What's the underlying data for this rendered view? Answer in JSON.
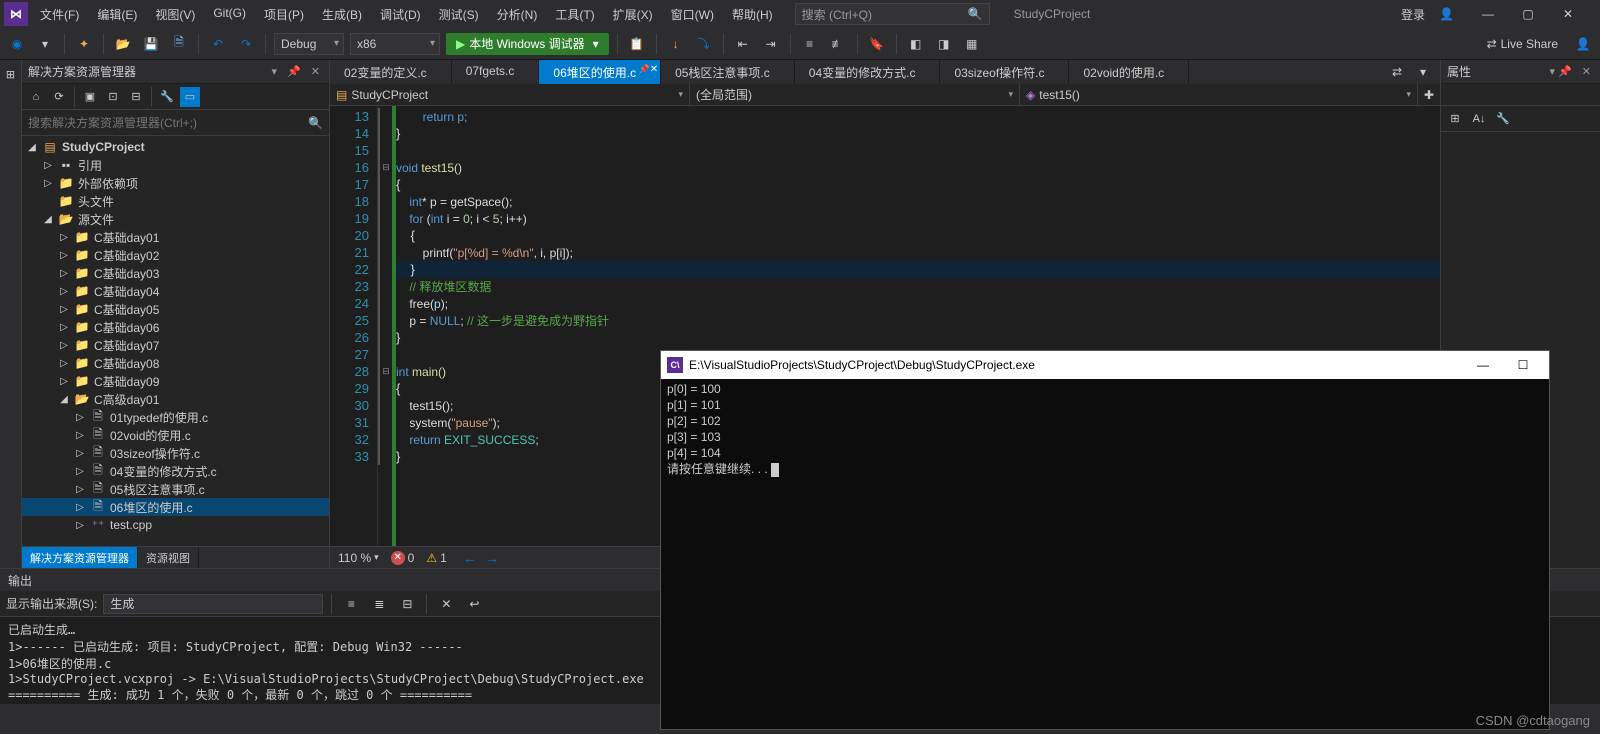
{
  "menu": {
    "file": "文件(F)",
    "edit": "编辑(E)",
    "view": "视图(V)",
    "git": "Git(G)",
    "project": "项目(P)",
    "build": "生成(B)",
    "debug": "调试(D)",
    "test": "测试(S)",
    "analyze": "分析(N)",
    "tools": "工具(T)",
    "extensions": "扩展(X)",
    "window": "窗口(W)",
    "help": "帮助(H)"
  },
  "searchPlaceholder": "搜索 (Ctrl+Q)",
  "appTitle": "StudyCProject",
  "login": "登录",
  "toolbar": {
    "config": "Debug",
    "platform": "x86",
    "start": "本地 Windows 调试器",
    "liveShare": "Live Share"
  },
  "solExp": {
    "title": "解决方案资源管理器",
    "searchPlaceholder": "搜索解决方案资源管理器(Ctrl+;)",
    "tabs": {
      "sol": "解决方案资源管理器",
      "res": "资源视图"
    }
  },
  "tree": {
    "project": "StudyCProject",
    "refs": "引用",
    "extdep": "外部依赖项",
    "headers": "头文件",
    "sources": "源文件",
    "folders": [
      "C基础day01",
      "C基础day02",
      "C基础day03",
      "C基础day04",
      "C基础day05",
      "C基础day06",
      "C基础day07",
      "C基础day08",
      "C基础day09",
      "C高级day01"
    ],
    "files": [
      "01typedef的使用.c",
      "02void的使用.c",
      "03sizeof操作符.c",
      "04变量的修改方式.c",
      "05栈区注意事项.c",
      "06堆区的使用.c",
      "test.cpp"
    ]
  },
  "fileTabs": [
    {
      "name": "02变量的定义.c"
    },
    {
      "name": "07fgets.c"
    },
    {
      "name": "06堆区的使用.c",
      "active": true
    },
    {
      "name": "05栈区注意事项.c"
    },
    {
      "name": "04变量的修改方式.c"
    },
    {
      "name": "03sizeof操作符.c"
    },
    {
      "name": "02void的使用.c"
    }
  ],
  "breadcrumb": {
    "proj": "StudyCProject",
    "scope": "(全局范围)",
    "func": "test15()"
  },
  "code": {
    "lines": [
      13,
      14,
      15,
      16,
      17,
      18,
      19,
      20,
      21,
      22,
      23,
      24,
      25,
      26,
      27,
      28,
      29,
      30,
      31,
      32,
      33
    ],
    "l13": "        return p;",
    "l16": {
      "a": "void",
      "b": " test15()"
    },
    "l18": {
      "a": "    int",
      "b": "* p = getSpace();"
    },
    "l19": {
      "a": "    for",
      "b": " (",
      "c": "int",
      "d": " i = ",
      "n0": "0",
      "e": "; i < ",
      "n5": "5",
      "f": "; i++)"
    },
    "l21a": "        printf(",
    "l21s": "\"p[%d] = %d\\n\"",
    "l21b": ", i, p[i]);",
    "l23": "    // 释放堆区数据",
    "l24a": "    free(",
    "l24b": "p",
    "l24c": ");",
    "l25a": "    p = ",
    "l25n": "NULL",
    "l25b": "; ",
    "l25c": "// 这一步是避免成为野指针",
    "l28a": "int",
    "l28b": " main()",
    "l30": "    test15();",
    "l31a": "    system(",
    "l31s": "\"pause\"",
    "l31b": ");",
    "l32a": "    return ",
    "l32b": "EXIT_SUCCESS",
    "l32c": ";"
  },
  "status": {
    "zoom": "110 %",
    "errors": "0",
    "warnings": "1"
  },
  "props": {
    "title": "属性"
  },
  "output": {
    "title": "输出",
    "srcLabel": "显示输出来源(S):",
    "src": "生成",
    "text": "已启动生成…\n1>------ 已启动生成: 项目: StudyCProject, 配置: Debug Win32 ------\n1>06堆区的使用.c\n1>StudyCProject.vcxproj -> E:\\VisualStudioProjects\\StudyCProject\\Debug\\StudyCProject.exe\n========== 生成: 成功 1 个，失败 0 个，最新 0 个，跳过 0 个 =========="
  },
  "console": {
    "title": "E:\\VisualStudioProjects\\StudyCProject\\Debug\\StudyCProject.exe",
    "body": "p[0] = 100\np[1] = 101\np[2] = 102\np[3] = 103\np[4] = 104\n请按任意键继续. . . "
  },
  "watermark": "CSDN @cdtaogang"
}
